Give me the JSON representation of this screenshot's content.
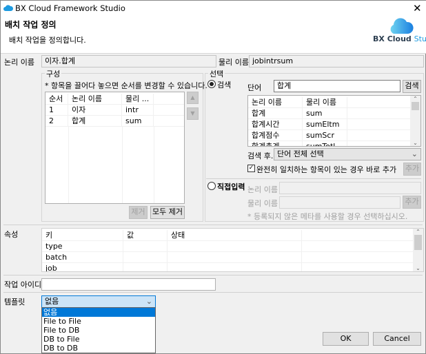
{
  "window": {
    "title": "BX Cloud Framework Studio",
    "close_icon": "close-icon"
  },
  "header": {
    "title": "배치 작업 정의",
    "subtitle": "배치 작업을 정의합니다.",
    "logo_text_bx": "BX Cloud",
    "logo_text_studio": "Studio"
  },
  "names": {
    "logical_label": "논리 이름",
    "logical_value": "이자.합계",
    "physical_label": "물리 이름",
    "physical_value": "jobintrsum"
  },
  "composition": {
    "title": "구성",
    "hint": "* 항목을 끌어다 놓으면 순서를 변경할 수 있습니다.",
    "columns": [
      "순서",
      "논리 이름",
      "물리 ..."
    ],
    "rows": [
      [
        "1",
        "이자",
        "intr"
      ],
      [
        "2",
        "합계",
        "sum"
      ]
    ],
    "remove_label": "제거",
    "remove_all_label": "모두 제거"
  },
  "selection": {
    "title": "선택",
    "search_radio": "검색",
    "word_label": "단어",
    "word_value": "합계",
    "search_button": "검색",
    "columns": [
      "논리 이름",
      "물리 이름"
    ],
    "rows": [
      [
        "합계",
        "sum"
      ],
      [
        "합계시간",
        "sumEltm"
      ],
      [
        "합계점수",
        "sumScr"
      ],
      [
        "합계총계",
        "sumTotl"
      ]
    ],
    "after_search_label": "검색 후..",
    "after_search_value": "단어 전체 선택",
    "exact_match_label": "완전히 일치하는 항목이 있는 경우 바로 추가",
    "exact_match_checked": true,
    "add_label": "추가",
    "direct_radio": "직접입력",
    "direct_logical_label": "논리 이름",
    "direct_physical_label": "물리 이름",
    "direct_add_label": "추가",
    "direct_hint": "* 등록되지 않은 메타를 사용할 경우 선택하십시오."
  },
  "properties": {
    "label": "속성",
    "columns": [
      "키",
      "값",
      "상태"
    ],
    "rows": [
      "type",
      "batch",
      "job"
    ]
  },
  "job_id": {
    "label": "작업 아이디",
    "value": ""
  },
  "template": {
    "label": "템플릿",
    "value": "없음",
    "options": [
      "없음",
      "File to File",
      "File to DB",
      "DB to File",
      "DB to DB"
    ],
    "selected_index": 0
  },
  "footer": {
    "ok": "OK",
    "cancel": "Cancel"
  },
  "colors": {
    "selection": "#0078d7",
    "combo_focus": "#cce4f7",
    "logo": "#1e9be0"
  }
}
